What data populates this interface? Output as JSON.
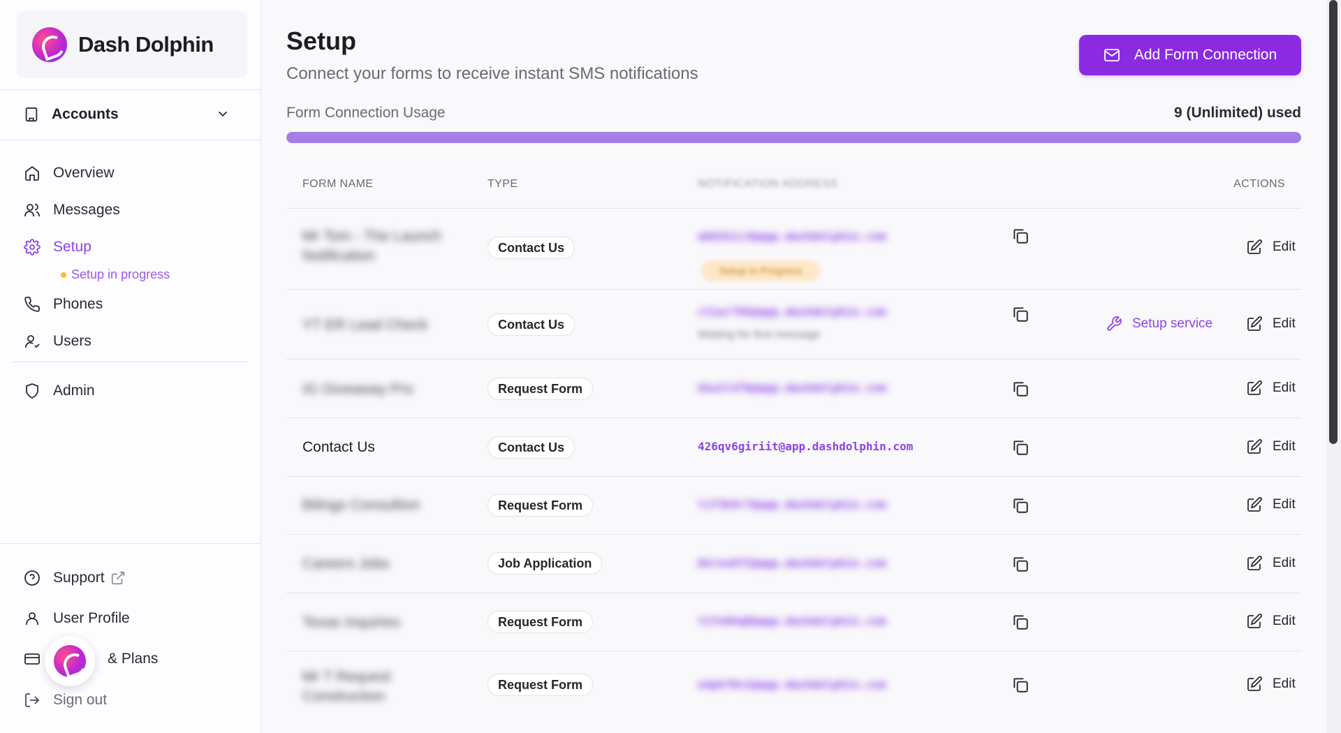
{
  "brand": {
    "name": "Dash Dolphin",
    "logo_icon": "dolphin-logo-icon"
  },
  "sidebar": {
    "accounts_label": "Accounts",
    "items": [
      {
        "label": "Overview",
        "icon": "home-icon"
      },
      {
        "label": "Messages",
        "icon": "users-icon"
      },
      {
        "label": "Setup",
        "icon": "gear-icon",
        "active": true
      },
      {
        "label": "Phones",
        "icon": "phone-icon"
      },
      {
        "label": "Users",
        "icon": "user-check-icon"
      },
      {
        "label": "Admin",
        "icon": "shield-icon"
      }
    ],
    "setup_status": "Setup in progress",
    "bottom_items": [
      {
        "label": "Support",
        "icon": "help-circle-icon"
      },
      {
        "label": "User Profile",
        "icon": "user-icon"
      },
      {
        "label": "& Plans",
        "icon": "credit-card-icon"
      },
      {
        "label": "Sign out",
        "icon": "sign-out-icon"
      }
    ]
  },
  "header": {
    "title": "Setup",
    "subtitle": "Connect your forms to receive instant SMS notifications",
    "add_button_label": "Add Form Connection"
  },
  "usage": {
    "label": "Form Connection Usage",
    "value": "9 (Unlimited) used",
    "fill_fraction": 1.0
  },
  "table": {
    "headers": {
      "form_name": "FORM NAME",
      "type": "TYPE",
      "address": "NOTIFICATION ADDRESS",
      "actions": "ACTIONS"
    },
    "rows": [
      {
        "name": "Mr Tom - The Launch Notification",
        "type": "Contact Us",
        "email": "ab82k1c3@app.dashdolphin.com",
        "badge": "Setup in Progress",
        "name_hidden": true,
        "email_hidden": true
      },
      {
        "name": "YT ER Lead Check",
        "type": "Contact Us",
        "email": "ct1wr76k@app.dashdolphin.com",
        "email_sub": "Waiting for first message",
        "setup_service": "Setup service",
        "name_hidden": true,
        "email_hidden": true
      },
      {
        "name": "IG Giveaway Pro",
        "type": "Request Form",
        "email": "kkw1l47b@app.dashdolphin.com",
        "name_hidden": true,
        "email_hidden": true
      },
      {
        "name": "Contact Us",
        "type": "Contact Us",
        "email": "426qv6giriit@app.dashdolphin.com",
        "name_hidden": false,
        "email_hidden": false
      },
      {
        "name": "Bilingo Consultion",
        "type": "Request Form",
        "email": "l1f3k8r7@app.dashdolphin.com",
        "name_hidden": true,
        "email_hidden": true
      },
      {
        "name": "Careers Jobs",
        "type": "Job Application",
        "email": "bkrnu8f2@app.dashdolphin.com",
        "name_hidden": true,
        "email_hidden": true
      },
      {
        "name": "Texas Inquiries",
        "type": "Request Form",
        "email": "t1fo6hq0@app.dashdolphin.com",
        "name_hidden": true,
        "email_hidden": true
      },
      {
        "name": "Mr T Request Construction",
        "type": "Request Form",
        "email": "w4pkf0s1@app.dashdolphin.com",
        "name_hidden": true,
        "email_hidden": true
      }
    ],
    "edit_label": "Edit"
  },
  "colors": {
    "accent": "#8a2be2",
    "accent_text": "#8b44e6",
    "usage_fill": "#a57ee6",
    "status_dot": "#f6c02b"
  }
}
